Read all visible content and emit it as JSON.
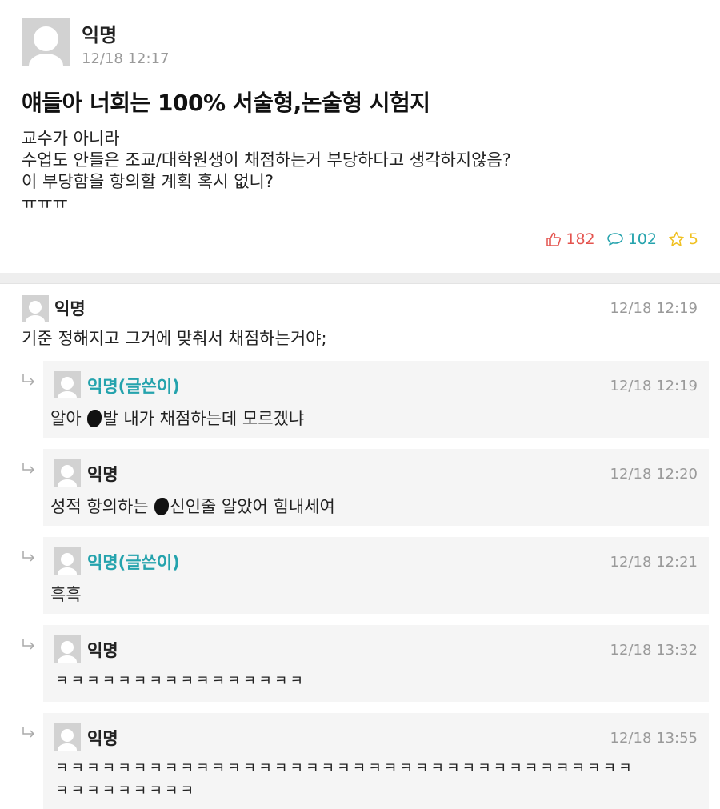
{
  "post": {
    "author": "익명",
    "time": "12/18 12:17",
    "title": "얘들아 너희는 100% 서술형,논술형 시험지",
    "body_lines": [
      "교수가 아니라",
      "수업도 안들은 조교/대학원생이 채점하는거 부당하다고 생각하지않음?",
      "이 부당함을 항의할 계획 혹시 없니?",
      "ㅠㅠㅠ"
    ],
    "likes": "182",
    "comments": "102",
    "scraps": "5"
  },
  "comment": {
    "author": "익명",
    "time": "12/18 12:19",
    "text": "기준 정해지고 그거에 맞춰서 채점하는거야;"
  },
  "replies": [
    {
      "author": "익명(글쓴이)",
      "time": "12/18 12:19",
      "text_before": "알아 ",
      "text_after": "발 내가 채점하는데 모르겠냐"
    },
    {
      "author": "익명",
      "time": "12/18 12:20",
      "text_before": "성적 항의하는 ",
      "text_after": "신인줄 알았어 힘내세여"
    },
    {
      "author": "익명(글쓴이)",
      "time": "12/18 12:21",
      "text": "흑흑"
    },
    {
      "author": "익명",
      "time": "12/18 13:32",
      "text": "ㅋㅋㅋㅋㅋㅋㅋㅋㅋㅋㅋㅋㅋㅋㅋㅋ"
    },
    {
      "author": "익명",
      "time": "12/18 13:55",
      "text_line1": "ㅋㅋㅋㅋㅋㅋㅋㅋㅋㅋㅋㅋㅋㅋㅋㅋㅋㅋㅋㅋㅋㅋㅋㅋㅋㅋㅋㅋㅋㅋㅋㅋㅋㅋㅋㅋㅋ",
      "text_line2": "ㅋㅋㅋㅋㅋㅋㅋㅋㅋ"
    }
  ],
  "colors": {
    "op_author": "#25a3ad",
    "like": "#e4544f",
    "comment": "#25a3ad",
    "scrap": "#f0c020"
  },
  "icons": {
    "like": "thumbs-up-icon",
    "comment": "speech-bubble-icon",
    "scrap": "star-icon",
    "reply": "reply-arrow-icon"
  }
}
